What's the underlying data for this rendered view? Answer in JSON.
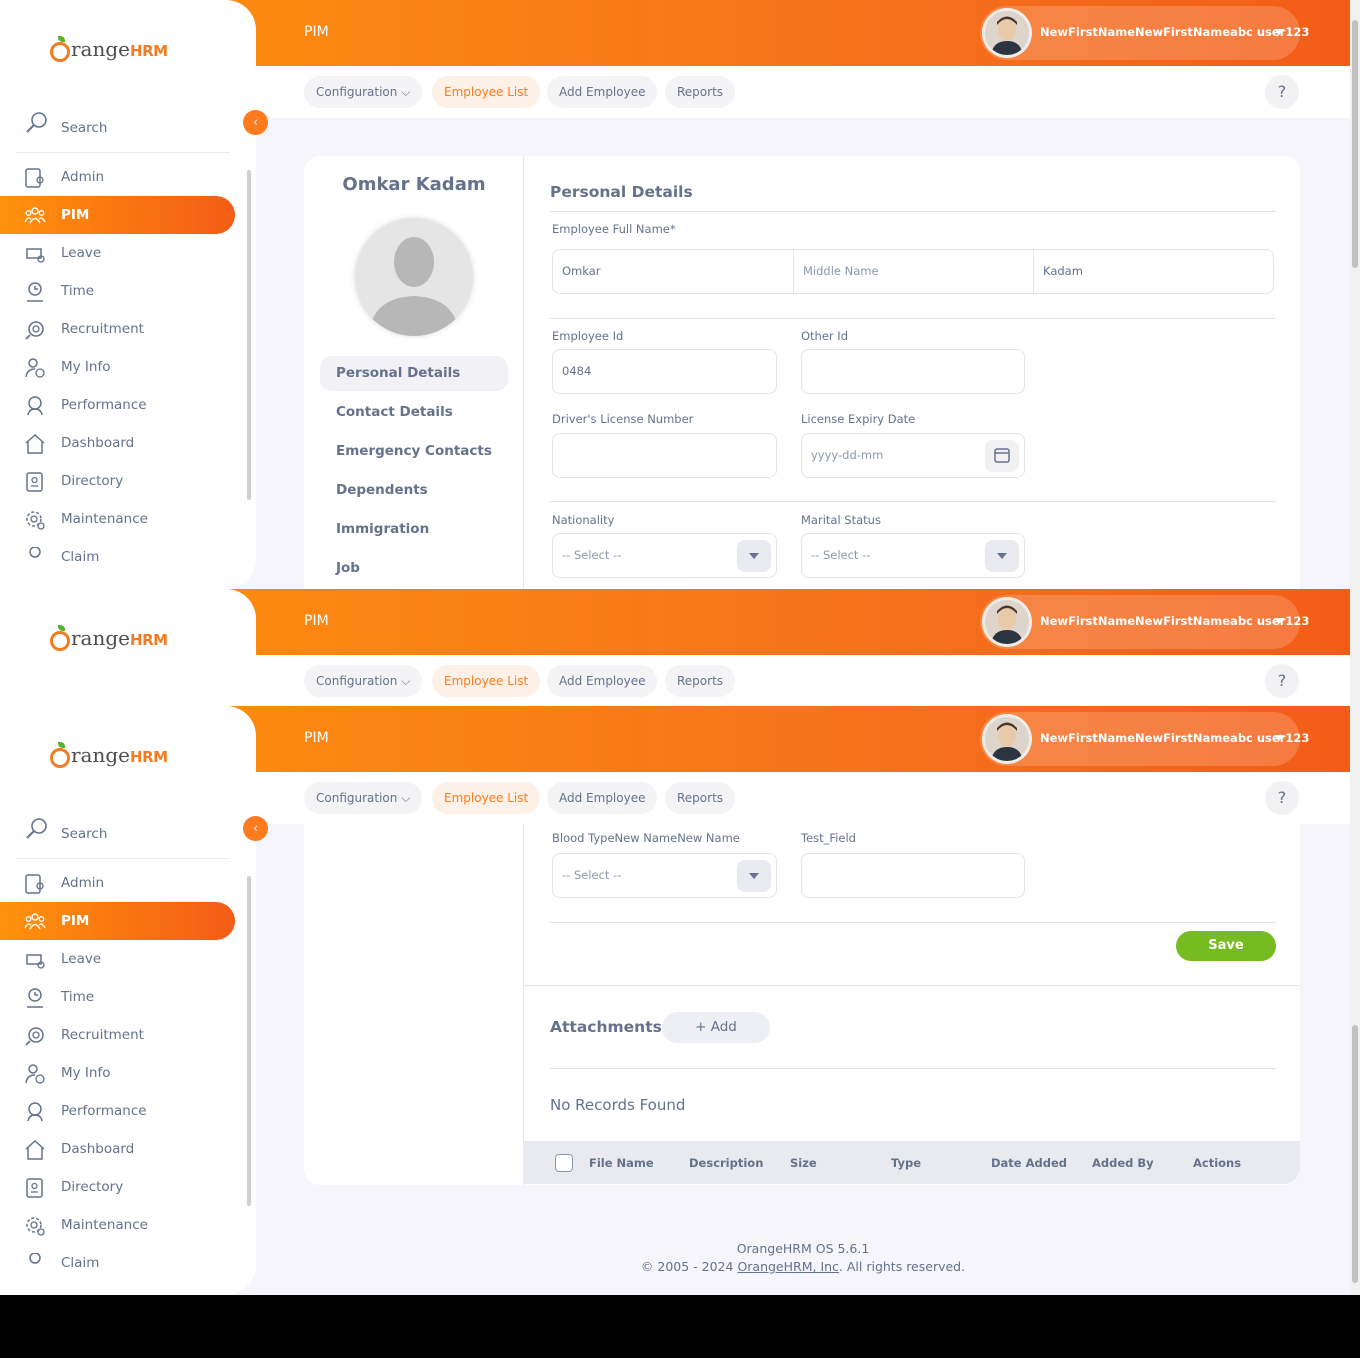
{
  "header": {
    "title": "PIM",
    "user_name": "NewFirstNameNewFirstNameabc user123"
  },
  "subnav": {
    "configuration": "Configuration",
    "employee_list": "Employee List",
    "add_employee": "Add Employee",
    "reports": "Reports",
    "help": "?"
  },
  "sidebar": {
    "logo_o": "O",
    "logo_text": "range",
    "logo_hrm": "HRM",
    "search_label": "Search",
    "items": [
      {
        "label": "Admin",
        "icon": "admin-icon"
      },
      {
        "label": "PIM",
        "icon": "pim-icon"
      },
      {
        "label": "Leave",
        "icon": "leave-icon"
      },
      {
        "label": "Time",
        "icon": "time-icon"
      },
      {
        "label": "Recruitment",
        "icon": "recruitment-icon"
      },
      {
        "label": "My Info",
        "icon": "my-info-icon"
      },
      {
        "label": "Performance",
        "icon": "performance-icon"
      },
      {
        "label": "Dashboard",
        "icon": "dashboard-icon"
      },
      {
        "label": "Directory",
        "icon": "directory-icon"
      },
      {
        "label": "Maintenance",
        "icon": "maintenance-icon"
      },
      {
        "label": "Claim",
        "icon": "claim-icon"
      }
    ],
    "active": "PIM"
  },
  "employee": {
    "name": "Omkar Kadam",
    "tabs": [
      "Personal Details",
      "Contact Details",
      "Emergency Contacts",
      "Dependents",
      "Immigration",
      "Job"
    ]
  },
  "form": {
    "heading": "Personal Details",
    "full_name_label": "Employee Full Name*",
    "first_name": "Omkar",
    "middle_name_placeholder": "Middle Name",
    "last_name": "Kadam",
    "employee_id_label": "Employee Id",
    "employee_id": "0484",
    "other_id_label": "Other Id",
    "license_label": "Driver's License Number",
    "license_expiry_label": "License Expiry Date",
    "date_placeholder": "yyyy-dd-mm",
    "nationality_label": "Nationality",
    "marital_label": "Marital Status",
    "select_placeholder": "-- Select --",
    "blood_type_label": "Blood TypeNew NameNew Name",
    "test_field_label": "Test_Field",
    "save": "Save"
  },
  "attachments": {
    "heading": "Attachments",
    "add": "+ Add",
    "empty": "No Records Found",
    "columns": [
      "File Name",
      "Description",
      "Size",
      "Type",
      "Date Added",
      "Added By",
      "Actions"
    ]
  },
  "footer": {
    "version": "OrangeHRM OS 5.6.1",
    "copyright_prefix": "© 2005 - 2024 ",
    "company_link": "OrangeHRM, Inc",
    "copyright_suffix": ". All rights reserved."
  },
  "colors": {
    "accent": "#ff7b1d",
    "save": "#76bc21",
    "text": "#64728c"
  }
}
